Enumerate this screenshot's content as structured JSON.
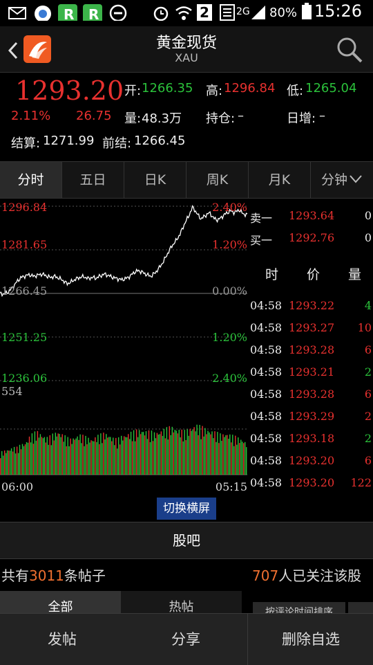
{
  "status_bar": {
    "time": "15:26",
    "battery": "80%",
    "network": "2G",
    "sim_slot": "2",
    "icons": [
      "mail-icon",
      "browser-icon",
      "r-app-icon",
      "r-app-icon",
      "minus-circle-icon",
      "alarm-icon",
      "wifi-icon",
      "sim-icon",
      "network-icon",
      "signal-icon",
      "battery-icon"
    ]
  },
  "header": {
    "title": "黄金现货",
    "subtitle": "XAU",
    "icons": [
      "back-icon",
      "app-logo-icon",
      "search-icon"
    ]
  },
  "quote": {
    "price": "1293.20",
    "change_pct": "2.11%",
    "change": "26.75",
    "open_label": "开:",
    "open": "1266.35",
    "high_label": "高:",
    "high": "1296.84",
    "low_label": "低:",
    "low": "1265.04",
    "volume_label": "量:",
    "volume": "48.3万",
    "position_label": "持仓:",
    "position": "–",
    "daily_inc_label": "日增:",
    "daily_inc": "–",
    "settle_label": "结算:",
    "settle": "1271.99",
    "prev_settle_label": "前结:",
    "prev_settle": "1266.45"
  },
  "tabs": [
    "分时",
    "五日",
    "日K",
    "周K",
    "月K",
    "分钟"
  ],
  "active_tab": 0,
  "colors": {
    "up": "#e8312f",
    "down": "#2bc23b",
    "background": "#000000",
    "accent_button": "#1a3e8a"
  },
  "chart_data": {
    "type": "line",
    "y_left_ticks": [
      "1296.84",
      "1281.65",
      "1266.45",
      "1251.25",
      "1236.06"
    ],
    "y_right_ticks": [
      "2.40%",
      "1.20%",
      "0.00%",
      "1.20%",
      "2.40%"
    ],
    "x_ticks": [
      "06:00",
      "05:15"
    ],
    "price_range": [
      1236.06,
      1296.84
    ],
    "baseline": 1266.45,
    "volume_max_label": "554",
    "price_series": [
      1266.45,
      1266.2,
      1267.0,
      1268.5,
      1270.5,
      1272.0,
      1272.5,
      1273.0,
      1272.4,
      1272.8,
      1273.2,
      1272.6,
      1272.0,
      1272.4,
      1271.8,
      1271.0,
      1269.8,
      1270.5,
      1271.4,
      1272.0,
      1272.3,
      1271.6,
      1272.0,
      1271.8,
      1272.6,
      1273.2,
      1272.6,
      1272.0,
      1271.6,
      1271.2,
      1271.6,
      1272.4,
      1273.8,
      1274.4,
      1273.8,
      1273.0,
      1272.4,
      1273.6,
      1275.4,
      1277.6,
      1280.4,
      1283.0,
      1284.8,
      1287.2,
      1290.6,
      1293.4,
      1296.6,
      1294.2,
      1292.4,
      1293.6,
      1294.6,
      1292.6,
      1292.0,
      1293.2,
      1294.4,
      1295.2,
      1294.6,
      1295.6,
      1294.2,
      1293.8
    ],
    "volume_series": [
      140,
      150,
      160,
      170,
      170,
      190,
      200,
      240,
      260,
      270,
      250,
      230,
      240,
      260,
      270,
      250,
      230,
      220,
      240,
      250,
      240,
      230,
      220,
      240,
      250,
      260,
      250,
      230,
      220,
      240,
      250,
      260,
      270,
      280,
      280,
      270,
      270,
      260,
      270,
      280,
      290,
      300,
      290,
      280,
      270,
      280,
      300,
      310,
      300,
      290,
      280,
      270,
      260,
      250,
      260,
      250,
      240,
      230,
      220,
      200
    ]
  },
  "order_book": {
    "sell_label": "卖一",
    "sell_price": "1293.64",
    "sell_vol": "0",
    "buy_label": "买一",
    "buy_price": "1292.76",
    "buy_vol": "0",
    "headers": [
      "时",
      "价",
      "量"
    ],
    "rows": [
      {
        "time": "04:58",
        "price": "1293.22",
        "vol": "4",
        "color": "green"
      },
      {
        "time": "04:58",
        "price": "1293.27",
        "vol": "10",
        "color": "red"
      },
      {
        "time": "04:58",
        "price": "1293.28",
        "vol": "6",
        "color": "red"
      },
      {
        "time": "04:58",
        "price": "1293.21",
        "vol": "2",
        "color": "green"
      },
      {
        "time": "04:58",
        "price": "1293.28",
        "vol": "6",
        "color": "red"
      },
      {
        "time": "04:58",
        "price": "1293.29",
        "vol": "2",
        "color": "red"
      },
      {
        "time": "04:58",
        "price": "1293.18",
        "vol": "2",
        "color": "green"
      },
      {
        "time": "04:58",
        "price": "1293.20",
        "vol": "6",
        "color": "red"
      },
      {
        "time": "04:58",
        "price": "1293.20",
        "vol": "122",
        "color": "red"
      }
    ]
  },
  "switch_button": "切换横屏",
  "guba": "股吧",
  "posts": {
    "prefix": "共有",
    "count": "3011",
    "suffix": "条帖子"
  },
  "followers": {
    "count": "707",
    "suffix": "人已关注该股"
  },
  "subtabs": [
    "全部",
    "热帖",
    "按评论时间排序"
  ],
  "bottom_bar": [
    "发帖",
    "分享",
    "删除自选"
  ]
}
